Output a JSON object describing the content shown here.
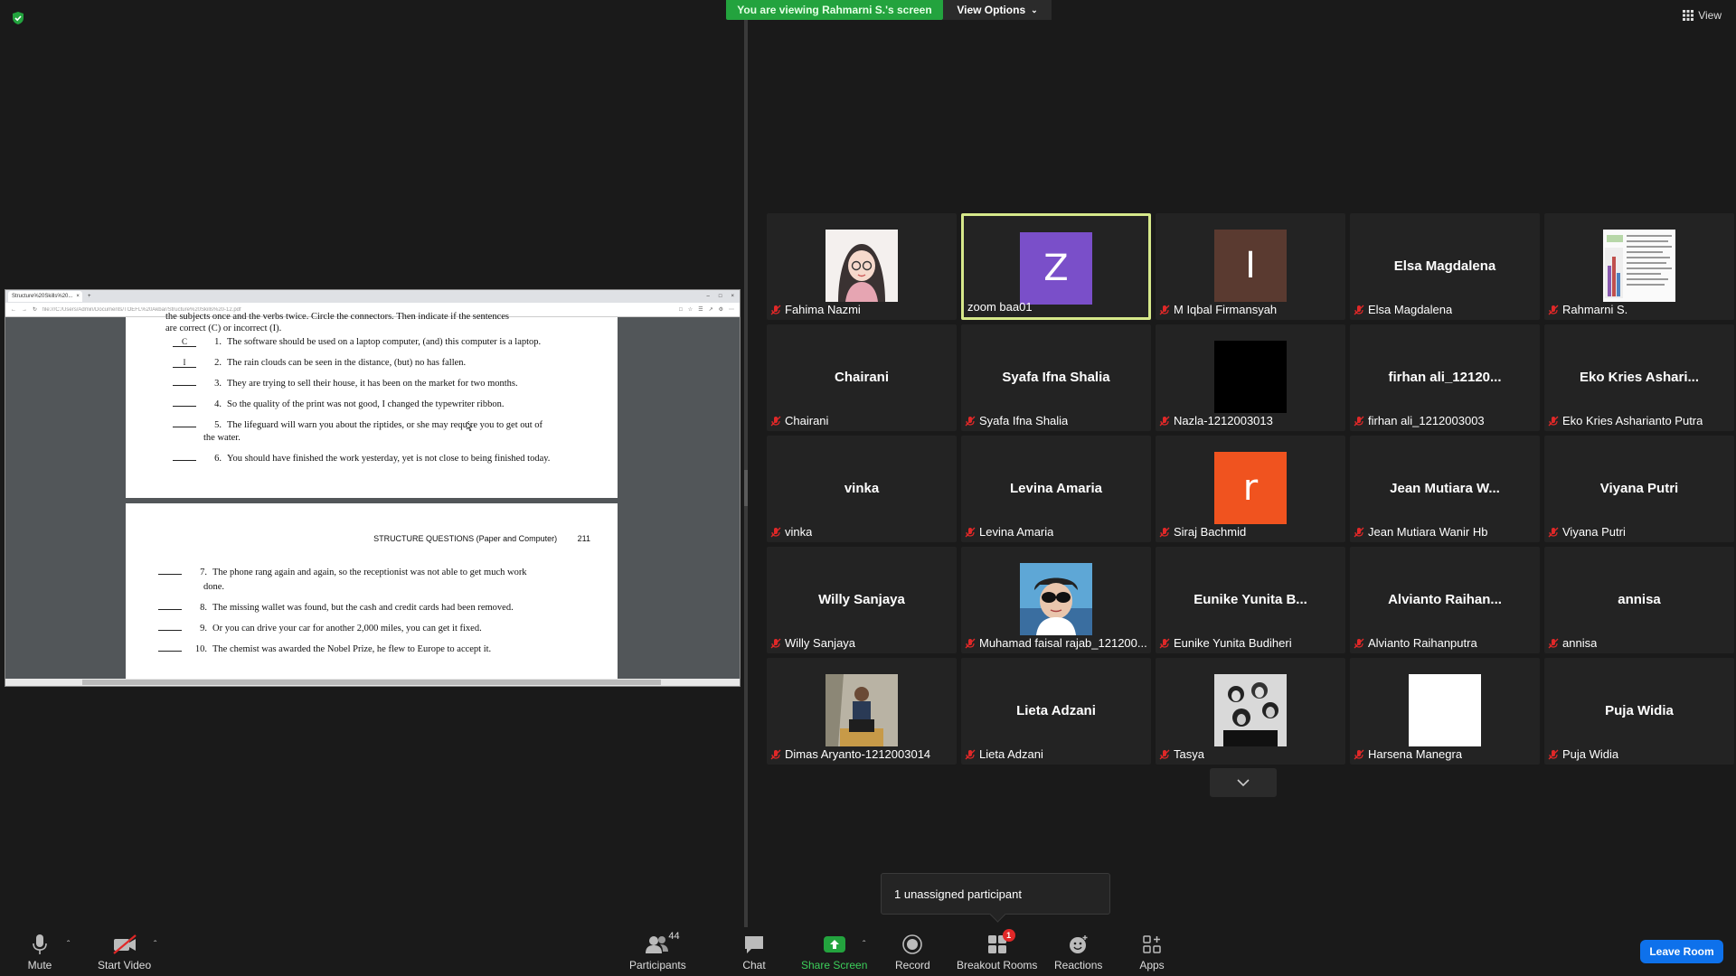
{
  "top": {
    "viewing_banner": "You are viewing Rahmarni S.'s screen",
    "view_options": "View Options",
    "view_label": "View"
  },
  "shared_screen": {
    "tab_title": "Structure%20Skills%20...",
    "address": "file:///C:/Users/Admin/Documents/TOEFL%20Akbar/Structure%20Skills%20-12.pdf",
    "intro_line1": "the subjects once and the verbs twice. Circle the connectors. Then indicate if the sentences",
    "intro_line2": "are correct (C) or incorrect (I).",
    "page_header": "STRUCTURE QUESTIONS (Paper and Computer)",
    "page_number": "211",
    "questions": [
      {
        "num": "1.",
        "answer": "C",
        "text": "The software should be used on a laptop computer, (and) this computer is a laptop."
      },
      {
        "num": "2.",
        "answer": "I",
        "text": "The rain clouds can be seen in the distance, (but) no has fallen."
      },
      {
        "num": "3.",
        "answer": "",
        "text": "They are trying to sell their house, it has been on the market for two months."
      },
      {
        "num": "4.",
        "answer": "",
        "text": "So the quality of the print was not good, I changed the typewriter ribbon."
      },
      {
        "num": "5.",
        "answer": "",
        "text": "The lifeguard will warn you about the riptides, or she may require you to get out of"
      },
      {
        "num": "",
        "answer": "",
        "text": "the water."
      },
      {
        "num": "6.",
        "answer": "",
        "text": "You should have finished the work yesterday, yet is not close to being finished today."
      }
    ],
    "questions2": [
      {
        "num": "7.",
        "text": "The phone rang again and again, so the receptionist was not able to get much work"
      },
      {
        "num": "",
        "text": "done."
      },
      {
        "num": "8.",
        "text": "The missing wallet was found, but the cash and credit cards had been removed."
      },
      {
        "num": "9.",
        "text": "Or you can drive your car for another 2,000 miles, you can get it fixed."
      },
      {
        "num": "10.",
        "text": "The chemist was awarded the Nobel Prize, he flew to Europe to accept it."
      }
    ]
  },
  "participants": [
    {
      "name": "Fahima Nazmi",
      "video": "avatar-hijab"
    },
    {
      "name": "zoom baa01",
      "video": "letter",
      "letter": "Z",
      "color": "#7a4fc9",
      "active": true
    },
    {
      "name": "M Iqbal Firmansyah",
      "video": "letter",
      "letter": "I",
      "color": "#5a3a30"
    },
    {
      "name": "Elsa Magdalena",
      "big": "Elsa Magdalena"
    },
    {
      "name": "Rahmarni S.",
      "video": "screen-thumb"
    },
    {
      "name": "Chairani",
      "big": "Chairani"
    },
    {
      "name": "Syafa Ifna Shalia",
      "big": "Syafa Ifna Shalia"
    },
    {
      "name": "Nazla-1212003013",
      "video": "black"
    },
    {
      "name": "firhan ali_1212003003",
      "big": "firhan ali_12120..."
    },
    {
      "name": "Eko Kries Asharianto Putra",
      "big": "Eko Kries Ashari..."
    },
    {
      "name": "vinka",
      "big": "vinka"
    },
    {
      "name": "Levina Amaria",
      "big": "Levina Amaria"
    },
    {
      "name": "Siraj Bachmid",
      "video": "letter",
      "letter": "r",
      "color": "#f0531f"
    },
    {
      "name": "Jean Mutiara Wanir Hb",
      "big": "Jean Mutiara W..."
    },
    {
      "name": "Viyana Putri",
      "big": "Viyana Putri"
    },
    {
      "name": "Willy Sanjaya",
      "big": "Willy Sanjaya"
    },
    {
      "name": "Muhamad faisal rajab_121200...",
      "video": "photo-sunglasses"
    },
    {
      "name": "Eunike Yunita Budiheri",
      "big": "Eunike Yunita B..."
    },
    {
      "name": "Alvianto Raihanputra",
      "big": "Alvianto  Raihan..."
    },
    {
      "name": "annisa",
      "big": "annisa"
    },
    {
      "name": "Dimas Aryanto-1212003014",
      "video": "photo-sitting"
    },
    {
      "name": "Lieta Adzani",
      "big": "Lieta Adzani"
    },
    {
      "name": "Tasya",
      "video": "photo-group"
    },
    {
      "name": "Harsena Manegra",
      "video": "white"
    },
    {
      "name": "Puja Widia",
      "big": "Puja Widia"
    }
  ],
  "unassigned": "1 unassigned participant",
  "toolbar": {
    "mute": "Mute",
    "start_video": "Start Video",
    "participants": "Participants",
    "participants_count": "44",
    "chat": "Chat",
    "share_screen": "Share Screen",
    "record": "Record",
    "breakout_rooms": "Breakout Rooms",
    "breakout_badge": "1",
    "reactions": "Reactions",
    "apps": "Apps",
    "leave": "Leave Room"
  },
  "colors": {
    "banner_green": "#23a33e",
    "active_border": "#d6e88a",
    "leave_blue": "#0e71eb",
    "muted_red": "#e02828"
  }
}
